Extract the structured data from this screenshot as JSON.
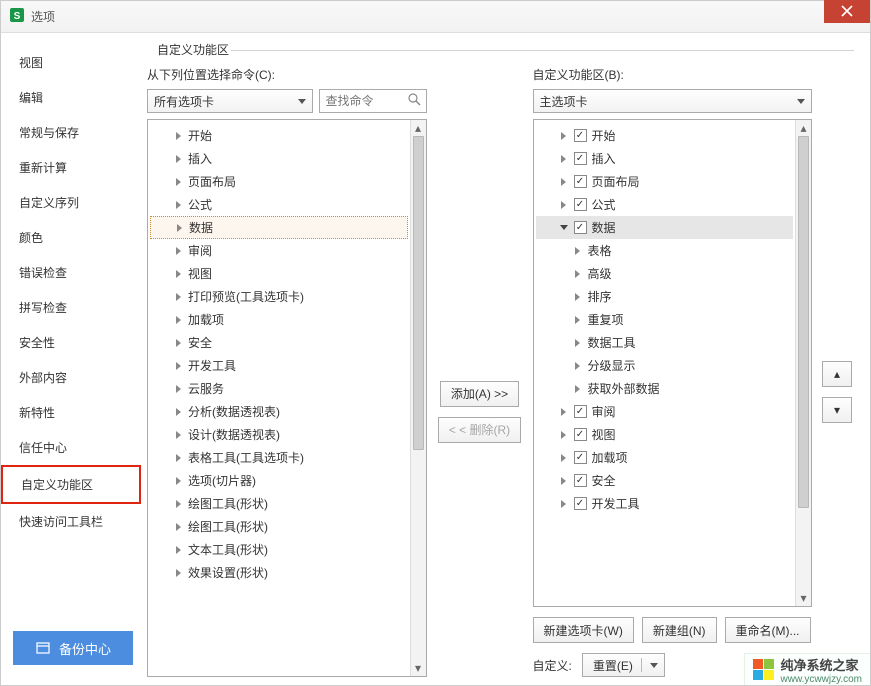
{
  "window": {
    "title": "选项"
  },
  "sidebar": {
    "items": [
      {
        "label": "视图"
      },
      {
        "label": "编辑"
      },
      {
        "label": "常规与保存"
      },
      {
        "label": "重新计算"
      },
      {
        "label": "自定义序列"
      },
      {
        "label": "颜色"
      },
      {
        "label": "错误检查"
      },
      {
        "label": "拼写检查"
      },
      {
        "label": "安全性"
      },
      {
        "label": "外部内容"
      },
      {
        "label": "新特性"
      },
      {
        "label": "信任中心"
      },
      {
        "label": "自定义功能区"
      },
      {
        "label": "快速访问工具栏"
      }
    ],
    "selected_index": 12
  },
  "main": {
    "section_title": "自定义功能区",
    "left": {
      "header": "从下列位置选择命令(C):",
      "tab_select": "所有选项卡",
      "search_placeholder": "查找命令",
      "tree": [
        {
          "expanded": false,
          "label": "开始"
        },
        {
          "expanded": false,
          "label": "插入"
        },
        {
          "expanded": false,
          "label": "页面布局"
        },
        {
          "expanded": false,
          "label": "公式"
        },
        {
          "expanded": false,
          "label": "数据",
          "highlight": true
        },
        {
          "expanded": false,
          "label": "审阅"
        },
        {
          "expanded": false,
          "label": "视图"
        },
        {
          "expanded": false,
          "label": "打印预览(工具选项卡)"
        },
        {
          "expanded": false,
          "label": "加载项"
        },
        {
          "expanded": false,
          "label": "安全"
        },
        {
          "expanded": false,
          "label": "开发工具"
        },
        {
          "expanded": false,
          "label": "云服务"
        },
        {
          "expanded": false,
          "label": "分析(数据透视表)"
        },
        {
          "expanded": false,
          "label": "设计(数据透视表)"
        },
        {
          "expanded": false,
          "label": "表格工具(工具选项卡)"
        },
        {
          "expanded": false,
          "label": "选项(切片器)"
        },
        {
          "expanded": false,
          "label": "绘图工具(形状)"
        },
        {
          "expanded": false,
          "label": "绘图工具(形状)"
        },
        {
          "expanded": false,
          "label": "文本工具(形状)"
        },
        {
          "expanded": false,
          "label": "效果设置(形状)"
        }
      ]
    },
    "middle": {
      "add_btn": "添加(A) >>",
      "remove_btn": "< < 删除(R)"
    },
    "right": {
      "header": "自定义功能区(B):",
      "tab_select": "主选项卡",
      "tree": [
        {
          "indent": 1,
          "expanded": false,
          "checked": true,
          "label": "开始"
        },
        {
          "indent": 1,
          "expanded": false,
          "checked": true,
          "label": "插入"
        },
        {
          "indent": 1,
          "expanded": false,
          "checked": true,
          "label": "页面布局"
        },
        {
          "indent": 1,
          "expanded": false,
          "checked": true,
          "label": "公式"
        },
        {
          "indent": 1,
          "expanded": true,
          "checked": true,
          "label": "数据",
          "selected": true
        },
        {
          "indent": 2,
          "leaf": true,
          "label": "表格"
        },
        {
          "indent": 2,
          "leaf": true,
          "label": "高级"
        },
        {
          "indent": 2,
          "leaf": true,
          "label": "排序"
        },
        {
          "indent": 2,
          "leaf": true,
          "label": "重复项"
        },
        {
          "indent": 2,
          "leaf": true,
          "label": "数据工具"
        },
        {
          "indent": 2,
          "leaf": true,
          "label": "分级显示"
        },
        {
          "indent": 2,
          "leaf": true,
          "label": "获取外部数据"
        },
        {
          "indent": 1,
          "expanded": false,
          "checked": true,
          "label": "审阅"
        },
        {
          "indent": 1,
          "expanded": false,
          "checked": true,
          "label": "视图"
        },
        {
          "indent": 1,
          "expanded": false,
          "checked": true,
          "label": "加载项"
        },
        {
          "indent": 1,
          "expanded": false,
          "checked": true,
          "label": "安全"
        },
        {
          "indent": 1,
          "expanded": false,
          "checked": true,
          "label": "开发工具"
        }
      ],
      "buttons": {
        "new_tab": "新建选项卡(W)",
        "new_group": "新建组(N)",
        "rename": "重命名(M)..."
      },
      "reset": {
        "label": "自定义:",
        "btn": "重置(E)"
      }
    }
  },
  "backup_btn": "备份中心",
  "watermark": {
    "text": "纯净系统之家",
    "url": "www.ycwwjzy.com"
  }
}
